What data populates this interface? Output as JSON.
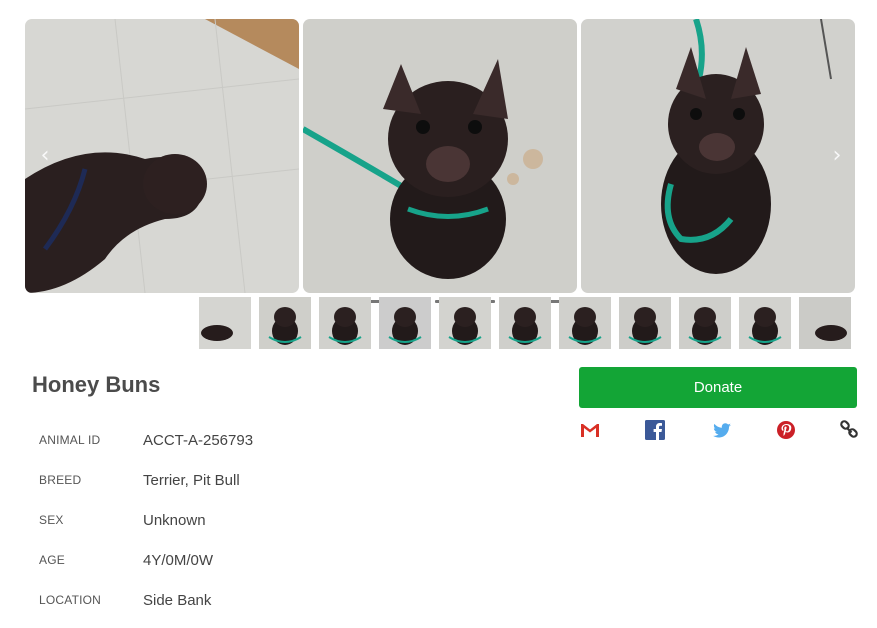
{
  "carousel": {
    "prev_icon": "chevron-left-icon",
    "next_icon": "chevron-right-icon",
    "prev_glyph": "‹",
    "next_glyph": "›",
    "slide_count": 11,
    "active_slide": 1
  },
  "thumbnails": {
    "count": 11
  },
  "pet": {
    "name": "Honey Buns",
    "details": [
      {
        "label": "ANIMAL ID",
        "value": "ACCT-A-256793"
      },
      {
        "label": "BREED",
        "value": "Terrier, Pit Bull"
      },
      {
        "label": "SEX",
        "value": "Unknown"
      },
      {
        "label": "AGE",
        "value": "4Y/0M/0W"
      },
      {
        "label": "LOCATION",
        "value": "Side Bank"
      }
    ]
  },
  "donate": {
    "label": "Donate",
    "color": "#13a536"
  },
  "share": [
    {
      "icon": "gmail-icon",
      "color": "#d93025"
    },
    {
      "icon": "facebook-icon",
      "color": "#3b5998"
    },
    {
      "icon": "twitter-icon",
      "color": "#55acee"
    },
    {
      "icon": "pinterest-icon",
      "color": "#cb2027"
    },
    {
      "icon": "link-icon",
      "color": "#333333"
    }
  ]
}
